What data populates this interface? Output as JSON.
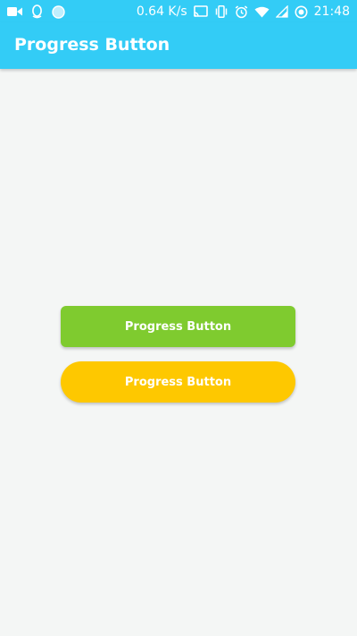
{
  "status_bar": {
    "network_speed": "0.64 K/s",
    "time": "21:48",
    "left_icons": [
      "video-camera-icon",
      "qq-penguin-icon",
      "round-app-icon"
    ],
    "right_icons": [
      "cast-icon",
      "vibrate-icon",
      "alarm-icon",
      "wifi-icon",
      "signal-icon",
      "record-icon"
    ],
    "color": "#33ccf6"
  },
  "app_bar": {
    "title": "Progress Button",
    "color": "#33ccf6"
  },
  "buttons": {
    "green": {
      "label": "Progress Button",
      "color": "#7fcb2f"
    },
    "yellow": {
      "label": "Progress Button",
      "color": "#fec800"
    }
  },
  "background": "#f4f6f5"
}
